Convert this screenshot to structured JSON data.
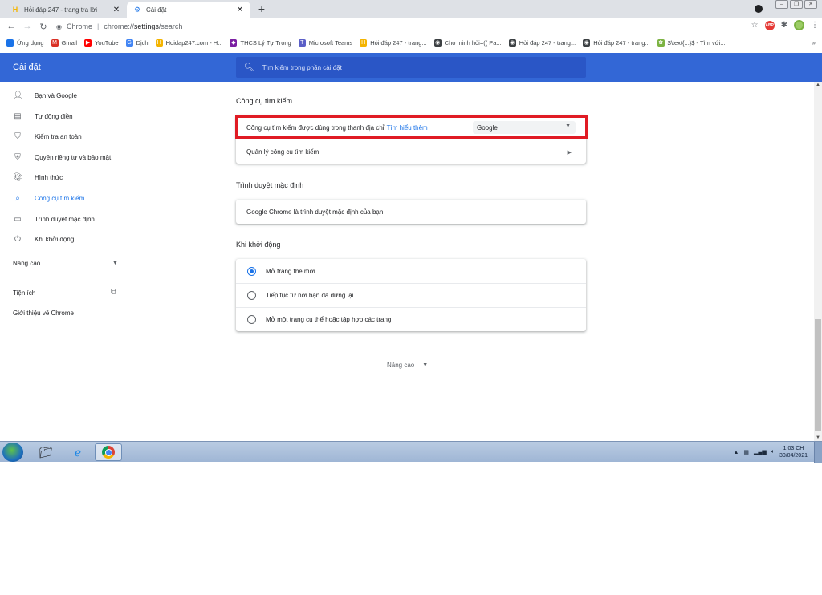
{
  "browser": {
    "tabs": [
      {
        "title": "Hỏi đáp 247 - trang tra lời",
        "icon": "hoidap-favicon",
        "active": false
      },
      {
        "title": "Cài đặt",
        "icon": "settings-gear-icon",
        "active": true
      }
    ],
    "new_tab": "+",
    "omnibox": {
      "site_name": "Chrome",
      "url_prefix": "chrome://",
      "url_path": "settings",
      "url_suffix": "/search"
    },
    "bookmarks": [
      {
        "label": "Ứng dụng",
        "icon": "apps-grid-icon",
        "color": "#1a73e8"
      },
      {
        "label": "Gmail",
        "icon": "gmail-icon",
        "color": "#d93025"
      },
      {
        "label": "YouTube",
        "icon": "youtube-icon",
        "color": "#ff0000"
      },
      {
        "label": "Dịch",
        "icon": "translate-icon",
        "color": "#4285f4"
      },
      {
        "label": "Hoidap247.com - H...",
        "icon": "hoidap-favicon",
        "color": "#f4b400"
      },
      {
        "label": "THCS Lý Tự Trọng",
        "icon": "school-icon",
        "color": "#7b1fa2"
      },
      {
        "label": "Microsoft Teams",
        "icon": "teams-icon",
        "color": "#5b5fc7"
      },
      {
        "label": "Hỏi đáp 247 - trang...",
        "icon": "hoidap-favicon",
        "color": "#f4b400"
      },
      {
        "label": "Cho minh hỏi=(( Pa...",
        "icon": "globe-icon",
        "color": "#3c4043"
      },
      {
        "label": "Hỏi đáp 247 - trang...",
        "icon": "globe-icon",
        "color": "#3c4043"
      },
      {
        "label": "Hỏi đáp 247 - trang...",
        "icon": "globe-icon",
        "color": "#3c4043"
      },
      {
        "label": "$\\text{...}$ - Tìm với...",
        "icon": "leaf-icon",
        "color": "#7cb342"
      }
    ],
    "bookmarks_more": "»"
  },
  "settings": {
    "title": "Cài đặt",
    "search_placeholder": "Tìm kiếm trong phần cài đặt",
    "accent": "#3367d6"
  },
  "sidebar": {
    "items": [
      {
        "label": "Bạn và Google",
        "icon": "person-icon"
      },
      {
        "label": "Tự động điền",
        "icon": "clipboard-icon"
      },
      {
        "label": "Kiểm tra an toàn",
        "icon": "shield-check-icon"
      },
      {
        "label": "Quyền riêng tư và bảo mật",
        "icon": "shield-lock-icon"
      },
      {
        "label": "Hình thức",
        "icon": "palette-icon"
      },
      {
        "label": "Công cụ tìm kiếm",
        "icon": "search-icon",
        "active": true
      },
      {
        "label": "Trình duyệt mặc định",
        "icon": "browser-window-icon"
      },
      {
        "label": "Khi khởi động",
        "icon": "power-icon"
      }
    ],
    "advanced": "Nâng cao",
    "extensions": "Tiện ích",
    "about": "Giới thiệu về Chrome"
  },
  "main": {
    "search_engine": {
      "heading": "Công cụ tìm kiếm",
      "address_bar_label": "Công cụ tìm kiếm được dùng trong thanh địa chỉ",
      "learn_more": "Tìm hiểu thêm",
      "selected_engine": "Google",
      "manage_label": "Quản lý công cụ tìm kiếm"
    },
    "default_browser": {
      "heading": "Trình duyệt mặc định",
      "status": "Google Chrome là trình duyệt mặc định của bạn"
    },
    "on_startup": {
      "heading": "Khi khởi động",
      "options": [
        {
          "label": "Mở trang thẻ mới",
          "checked": true
        },
        {
          "label": "Tiếp tục từ nơi bạn đã dừng lại",
          "checked": false
        },
        {
          "label": "Mở một trang cụ thể hoặc tập hợp các trang",
          "checked": false
        }
      ]
    },
    "advanced_button": "Nâng cao"
  },
  "taskbar": {
    "time": "1:03 CH",
    "date": "30/04/2021"
  }
}
